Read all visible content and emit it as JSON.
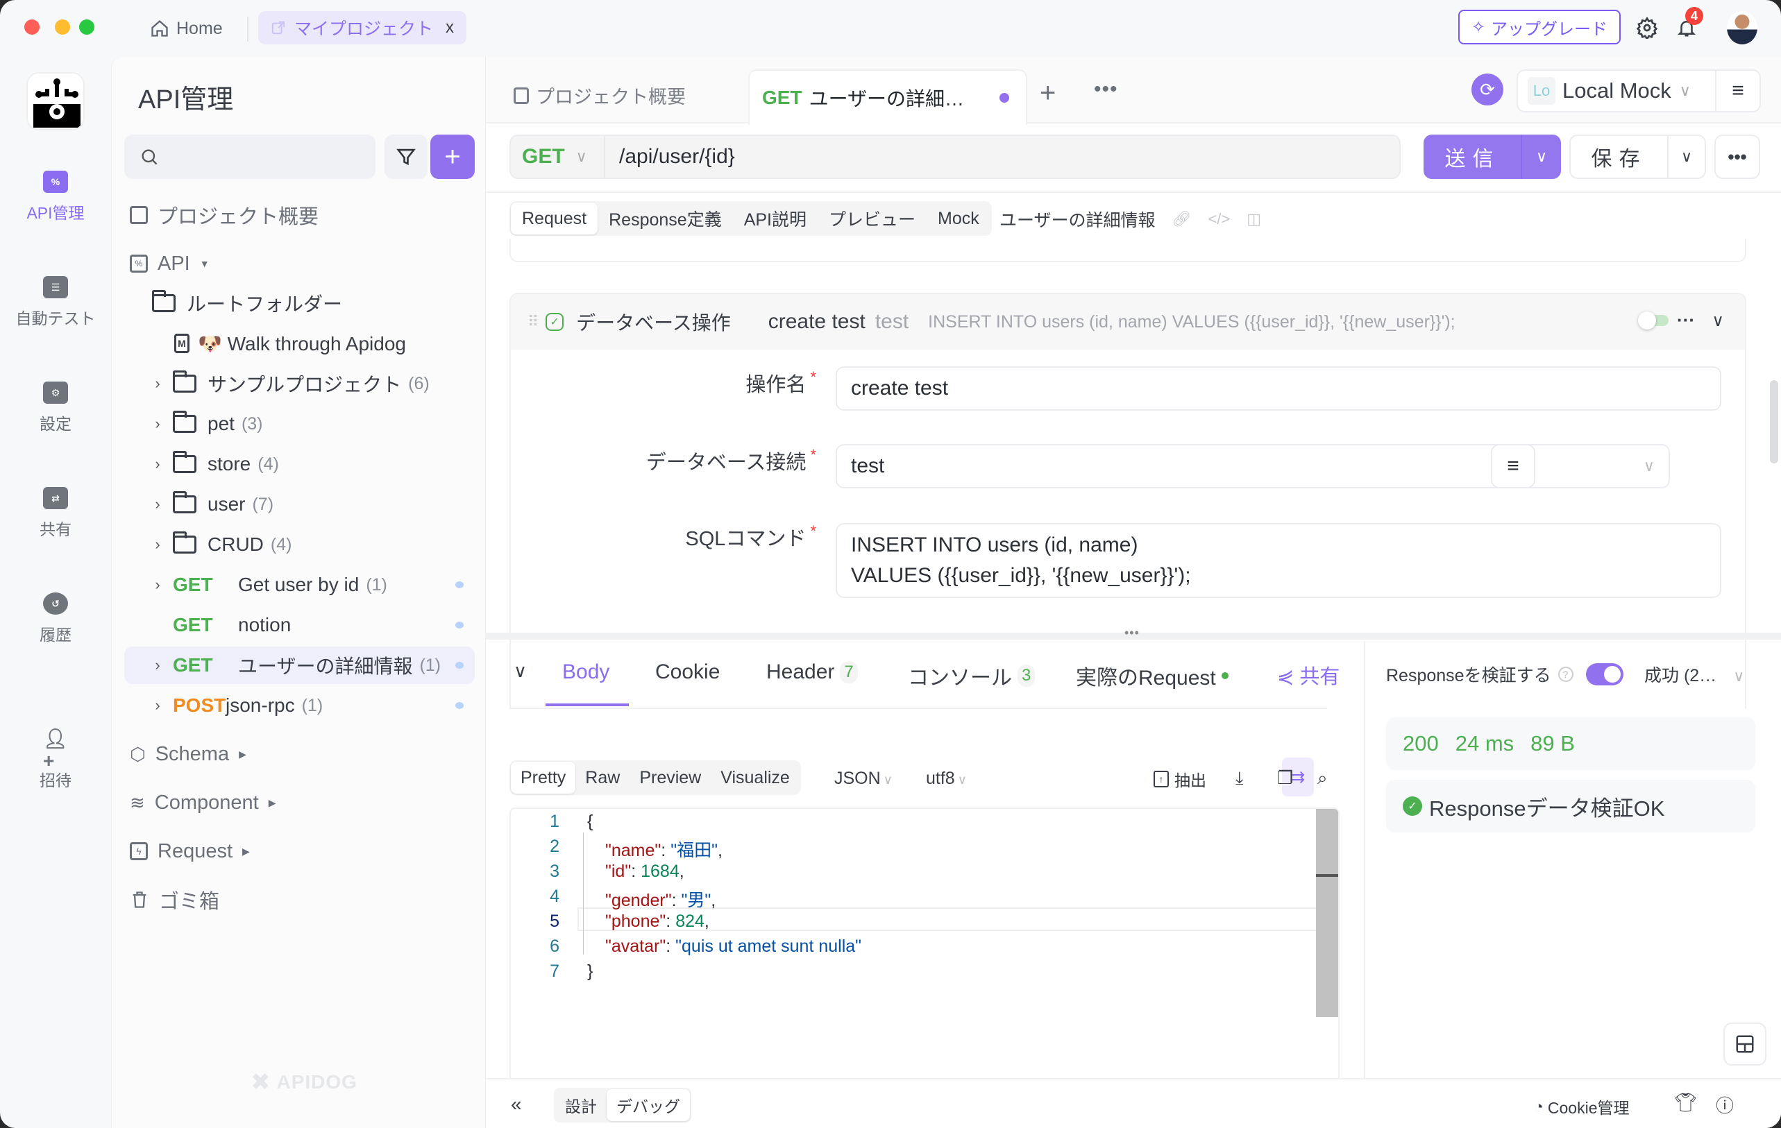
{
  "titlebar": {
    "home_label": "Home",
    "project_tab_label": "マイプロジェクト",
    "project_tab_close": "x",
    "upgrade_label": "アップグレード",
    "notification_count": "4"
  },
  "rail": {
    "items": [
      {
        "label": "API管理",
        "icon": "api-icon",
        "active": true
      },
      {
        "label": "自動テスト",
        "icon": "test-icon"
      },
      {
        "label": "設定",
        "icon": "settings-icon"
      },
      {
        "label": "共有",
        "icon": "share-icon"
      },
      {
        "label": "履歴",
        "icon": "history-icon"
      },
      {
        "label": "招待",
        "icon": "invite-icon"
      }
    ]
  },
  "sidebar": {
    "title": "API管理",
    "search_placeholder": "",
    "overview_label": "プロジェクト概要",
    "api_label": "API",
    "root_folder": "ルートフォルダー",
    "doc_item": "🐶 Walk through Apidog",
    "folders": [
      {
        "name": "サンプルプロジェクト",
        "count": "(6)"
      },
      {
        "name": "pet",
        "count": "(3)"
      },
      {
        "name": "store",
        "count": "(4)"
      },
      {
        "name": "user",
        "count": "(7)"
      },
      {
        "name": "CRUD",
        "count": "(4)"
      }
    ],
    "endpoints": [
      {
        "method": "GET",
        "name": "Get user by id",
        "count": "(1)"
      },
      {
        "method": "GET",
        "name": "notion",
        "count": ""
      },
      {
        "method": "GET",
        "name": "ユーザーの詳細情報",
        "count": "(1)",
        "selected": true
      },
      {
        "method": "POST",
        "name": "json-rpc",
        "count": "(1)"
      }
    ],
    "sections": [
      "Schema",
      "Component",
      "Request",
      "ゴミ箱"
    ],
    "watermark": "APIDOG"
  },
  "tabs": {
    "overview": "プロジェクト概要",
    "active_method": "GET",
    "active_title": "ユーザーの詳細…",
    "plus": "+",
    "more": "•••"
  },
  "environment": {
    "badge": "Lo",
    "name": "Local Mock"
  },
  "request": {
    "method": "GET",
    "path": "/api/user/{id}",
    "send_label": "送信",
    "save_label": "保存",
    "subtabs": [
      "Request",
      "Response定義",
      "API説明",
      "プレビュー",
      "Mock"
    ],
    "active_subtab": "Request",
    "api_name": "ユーザーの詳細情報"
  },
  "db_operation": {
    "type_label": "データベース操作",
    "name": "create test",
    "connection": "test",
    "summary_sql": "INSERT INTO users (id, name) VALUES ({{user_id}}, '{{new_user}}');",
    "fields": {
      "name_label": "操作名",
      "name_value": "create test",
      "conn_label": "データベース接続",
      "conn_value": "test",
      "sql_label": "SQLコマンド",
      "sql_line1": "INSERT INTO users (id, name)",
      "sql_line2": "VALUES ({{user_id}}, '{{new_user}}');",
      "required_mark": "*"
    }
  },
  "response": {
    "tabs": [
      {
        "label": "Body",
        "active": true
      },
      {
        "label": "Cookie"
      },
      {
        "label": "Header",
        "count": "7"
      },
      {
        "label": "コンソール",
        "count": "3"
      },
      {
        "label": "実際のRequest"
      }
    ],
    "share_label": "共有",
    "formats": [
      "Pretty",
      "Raw",
      "Preview",
      "Visualize"
    ],
    "active_format": "Pretty",
    "lang": "JSON",
    "encoding": "utf8",
    "extract_label": "抽出",
    "code_lines": [
      {
        "n": "1",
        "text": "{"
      },
      {
        "n": "2",
        "key": "\"name\"",
        "val": "\"福田\"",
        "type": "s"
      },
      {
        "n": "3",
        "key": "\"id\"",
        "val": "1684",
        "type": "n"
      },
      {
        "n": "4",
        "key": "\"gender\"",
        "val": "\"男\"",
        "type": "s"
      },
      {
        "n": "5",
        "key": "\"phone\"",
        "val": "824",
        "type": "n"
      },
      {
        "n": "6",
        "key": "\"avatar\"",
        "val": "\"quis ut amet sunt nulla\"",
        "type": "s",
        "last": true
      },
      {
        "n": "7",
        "text": "}"
      }
    ]
  },
  "validation": {
    "label": "Responseを検証する",
    "enabled": true,
    "status_select": "成功 (2…",
    "status_code": "200",
    "time": "24 ms",
    "size": "89 B",
    "result": "Responseデータ検証OK"
  },
  "footer": {
    "modes": [
      "設計",
      "デバッグ"
    ],
    "active_mode": "デバッグ",
    "cookie_label": "Cookie管理"
  }
}
